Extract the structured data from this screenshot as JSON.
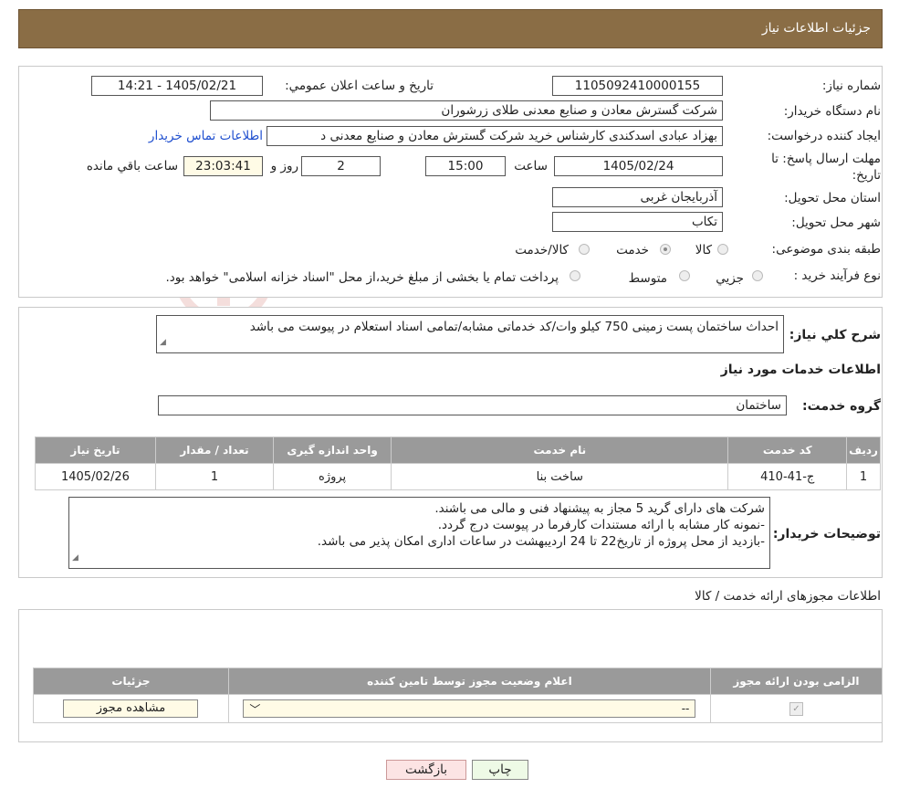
{
  "header": {
    "title": "جزئیات اطلاعات نیاز"
  },
  "form": {
    "need_number_label": "شماره نیاز:",
    "need_number": "1105092410000155",
    "announce_label": "تاریخ و ساعت اعلان عمومي:",
    "announce_value": "1405/02/21 - 14:21",
    "buyer_org_label": "نام دستگاه خریدار:",
    "buyer_org": "شرکت گسترش معادن و صنایع معدنی طلای زرشوران",
    "creator_label": "ایجاد کننده درخواست:",
    "creator": "بهزاد عبادی اسدکندی کارشناس خرید  شرکت گسترش معادن و صنایع معدنی د",
    "contact_link": "اطلاعات تماس خریدار",
    "deadline_label_1": "مهلت ارسال پاسخ: تا",
    "deadline_label_2": "تاریخ:",
    "deadline_date": "1405/02/24",
    "time_label": "ساعت",
    "deadline_time": "15:00",
    "days": "2",
    "days_label": "روز و",
    "remaining_time": "23:03:41",
    "remaining_label": "ساعت باقي مانده",
    "province_label": "استان محل تحویل:",
    "province": "آذربایجان غربی",
    "city_label": "شهر محل تحویل:",
    "city": "تکاب",
    "category_label": "طبقه بندی موضوعی:",
    "category_options": [
      "کالا",
      "خدمت",
      "کالا/خدمت"
    ],
    "category_selected": "خدمت",
    "process_label": "نوع فرآیند خرید :",
    "process_options": [
      "جزیي",
      "متوسط"
    ],
    "process_note": "پرداخت تمام یا بخشی از مبلغ خرید،از محل \"اسناد خزانه اسلامی\" خواهد بود."
  },
  "summary": {
    "label": "شرح کلي نیاز:",
    "text": "احداث ساختمان پست زمینی 750 کیلو وات/کد خدماتی مشابه/تمامی اسناد استعلام در پیوست می باشد"
  },
  "services": {
    "section_title": "اطلاعات خدمات مورد نیاز",
    "group_label": "گروه خدمت:",
    "group_value": "ساختمان",
    "columns": [
      "ردیف",
      "کد خدمت",
      "نام خدمت",
      "واحد اندازه گیری",
      "تعداد / مقدار",
      "تاریخ نیاز"
    ],
    "rows": [
      [
        "1",
        "ج-41-410",
        "ساخت بنا",
        "پروژه",
        "1",
        "1405/02/26"
      ]
    ]
  },
  "buyer_notes": {
    "label": "توضیحات خریدار:",
    "lines": [
      "شرکت های دارای گرید 5 مجاز به پیشنهاد فنی و مالی می باشند.",
      "-نمونه کار مشابه با ارائه مستندات کارفرما در پیوست درج گردد.",
      "-بازدید از محل پروژه از تاریخ22 تا 24 اردیبهشت در ساعات اداری امکان پذیر می باشد."
    ]
  },
  "permits": {
    "section_title": "اطلاعات مجوزهای ارائه خدمت / کالا",
    "columns": [
      "الزامی بودن ارائه مجوز",
      "اعلام وضعیت مجوز توسط تامین کننده",
      "جزئیات"
    ],
    "select_value": "--",
    "view_button": "مشاهده مجوز"
  },
  "actions": {
    "print": "چاپ",
    "back": "بازگشت"
  },
  "watermark": {
    "text": "AriaTender.neT"
  },
  "colors": {
    "header_bg": "#8a6d45",
    "table_header": "#9a9a9a",
    "link": "#1f4fcf",
    "back_btn": "#fce4e4",
    "print_btn": "#eefae6"
  }
}
